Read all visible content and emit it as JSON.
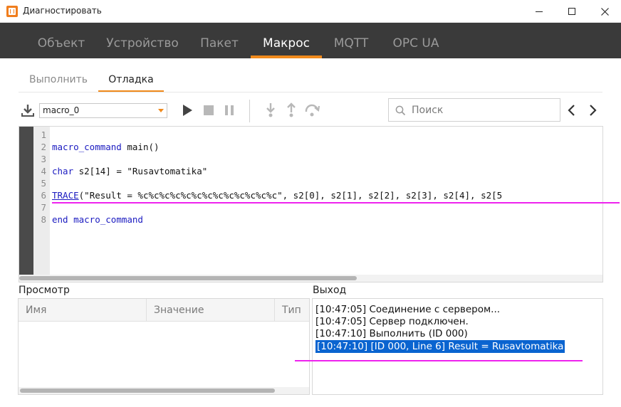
{
  "window": {
    "title": "Диагностировать"
  },
  "main_tabs": [
    {
      "label": "Объект",
      "active": false
    },
    {
      "label": "Устройство",
      "active": false
    },
    {
      "label": "Пакет",
      "active": false
    },
    {
      "label": "Макрос",
      "active": true
    },
    {
      "label": "MQTT",
      "active": false
    },
    {
      "label": "OPC UA",
      "active": false
    }
  ],
  "sub_tabs": [
    {
      "label": "Выполнить",
      "active": false
    },
    {
      "label": "Отладка",
      "active": true
    }
  ],
  "toolbar": {
    "macro_selected": "macro_0",
    "search_placeholder": "Поиск"
  },
  "editor": {
    "line_numbers": [
      "1",
      "2",
      "3",
      "4",
      "5",
      "6",
      "7",
      "8"
    ],
    "lines": {
      "l3_kw": "macro_command",
      "l3_rest": " main()",
      "l5_kw": "char",
      "l5_rest": " s2[14] = \"Rusavtomatika\"",
      "l7_fn": "TRACE",
      "l7_rest": "(\"Result = %c%c%c%c%c%c%c%c%c%c%c%c%c\", s2[0], s2[1], s2[2], s2[3], s2[4], s2[5",
      "l8_kw1": "end",
      "l8_kw2": "macro_command"
    }
  },
  "watch": {
    "title": "Просмотр",
    "columns": [
      "Имя",
      "Значение",
      "Тип"
    ]
  },
  "output": {
    "title": "Выход",
    "lines": [
      "[10:47:05] Соединение с сервером...",
      "[10:47:05] Сервер подключен.",
      "[10:47:10] Выполнить (ID 000)",
      "[10:47:10] [ID 000, Line 6] Result = Rusavtomatika"
    ]
  },
  "colors": {
    "accent": "#f08a1c",
    "tab_bar": "#3a3a3a",
    "selection": "#0a64d0",
    "annotation": "#ee22ee"
  }
}
